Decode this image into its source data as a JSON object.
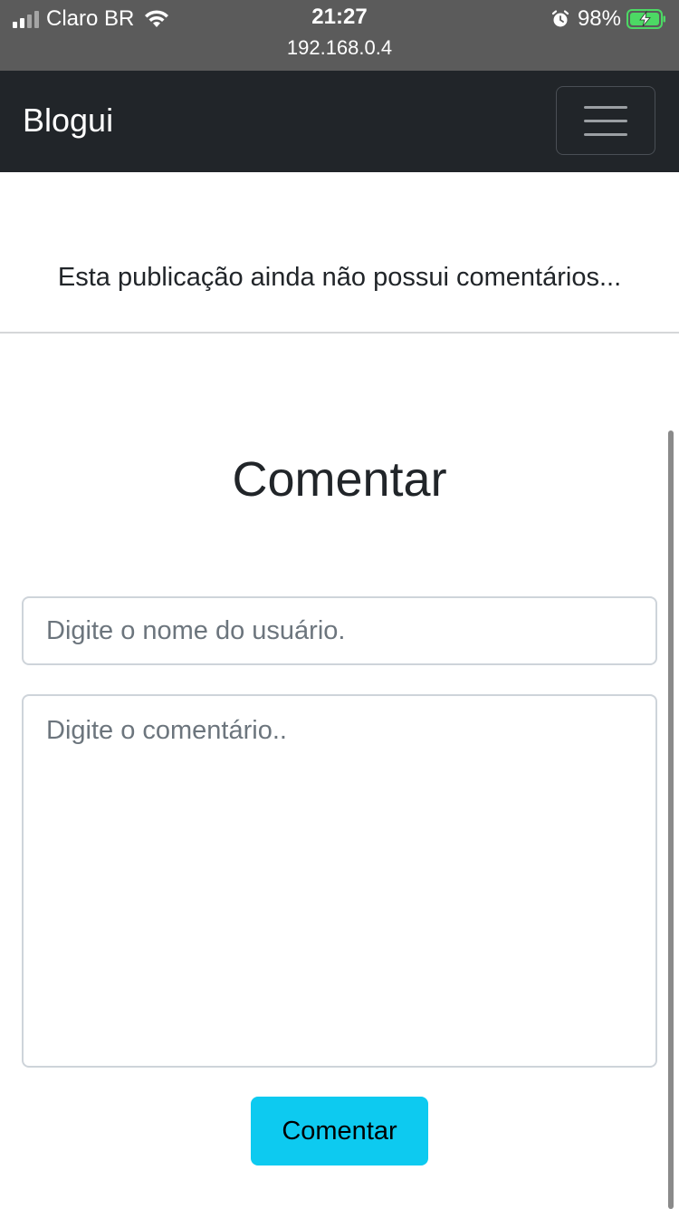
{
  "status_bar": {
    "carrier": "Claro BR",
    "time": "21:27",
    "url": "192.168.0.4",
    "battery_percent": "98%"
  },
  "navbar": {
    "brand": "Blogui",
    "toggler_icon": "hamburger-menu-icon"
  },
  "content": {
    "no_comments_text": "Esta publicação ainda não possui comentários..."
  },
  "comment_form": {
    "title": "Comentar",
    "username_placeholder": "Digite o nome do usuário.",
    "username_value": "",
    "comment_placeholder": "Digite o comentário..",
    "comment_value": "",
    "submit_label": "Comentar"
  },
  "colors": {
    "navbar_bg": "#212529",
    "button_info": "#0dcaf0",
    "battery_green": "#4cd964"
  }
}
